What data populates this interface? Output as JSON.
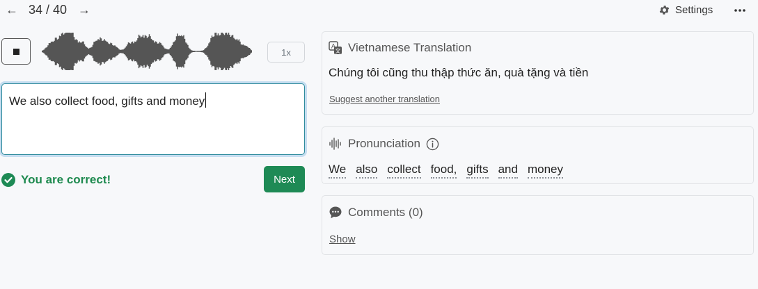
{
  "nav": {
    "prev_icon": "arrow-left-icon",
    "next_icon": "arrow-right-icon",
    "prev_glyph": "←",
    "next_glyph": "→",
    "counter": "34 / 40"
  },
  "header": {
    "settings_label": "Settings",
    "settings_icon": "gear-icon",
    "more_icon": "more-horizontal-icon"
  },
  "player": {
    "stop_icon": "stop-icon",
    "speed_label": "1x"
  },
  "answer": {
    "value": "We also collect food, gifts and money"
  },
  "feedback": {
    "text": "You are correct!",
    "icon": "check-circle-icon"
  },
  "next_button": {
    "label": "Next"
  },
  "translation_card": {
    "title": "Vietnamese Translation",
    "icon": "translate-icon",
    "text": "Chúng tôi cũng thu thập thức ăn, quà tặng và tiền",
    "suggest_link": "Suggest another translation"
  },
  "pronunciation_card": {
    "title": "Pronunciation",
    "icon": "soundwave-icon",
    "info_icon": "info-icon",
    "words": [
      "We",
      "also",
      "collect",
      "food,",
      "gifts",
      "and",
      "money"
    ]
  },
  "comments_card": {
    "title": "Comments (0)",
    "icon": "chat-bubble-icon",
    "show_link": "Show"
  },
  "colors": {
    "accent_green": "#1e8a55",
    "correct_text": "#1e8a4f",
    "focus_border": "#2e8b9c",
    "waveform": "#555555"
  }
}
